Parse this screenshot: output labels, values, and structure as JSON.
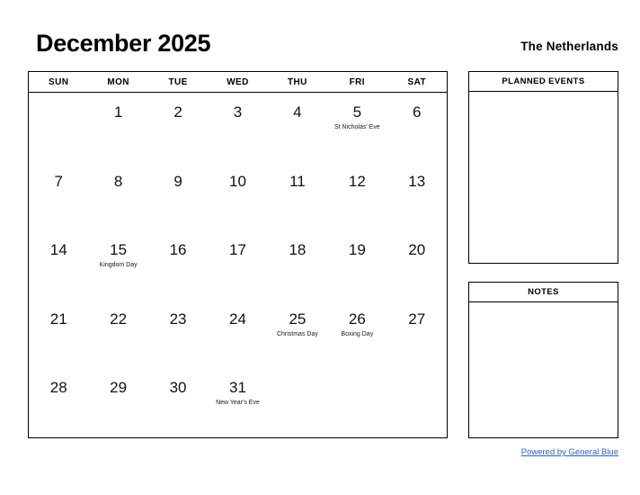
{
  "header": {
    "title": "December 2025",
    "region": "The Netherlands"
  },
  "calendar": {
    "weekdays": [
      "SUN",
      "MON",
      "TUE",
      "WED",
      "THU",
      "FRI",
      "SAT"
    ],
    "weeks": [
      [
        {
          "day": "",
          "event": ""
        },
        {
          "day": "1",
          "event": ""
        },
        {
          "day": "2",
          "event": ""
        },
        {
          "day": "3",
          "event": ""
        },
        {
          "day": "4",
          "event": ""
        },
        {
          "day": "5",
          "event": "St Nicholas' Eve"
        },
        {
          "day": "6",
          "event": ""
        }
      ],
      [
        {
          "day": "7",
          "event": ""
        },
        {
          "day": "8",
          "event": ""
        },
        {
          "day": "9",
          "event": ""
        },
        {
          "day": "10",
          "event": ""
        },
        {
          "day": "11",
          "event": ""
        },
        {
          "day": "12",
          "event": ""
        },
        {
          "day": "13",
          "event": ""
        }
      ],
      [
        {
          "day": "14",
          "event": ""
        },
        {
          "day": "15",
          "event": "Kingdom Day"
        },
        {
          "day": "16",
          "event": ""
        },
        {
          "day": "17",
          "event": ""
        },
        {
          "day": "18",
          "event": ""
        },
        {
          "day": "19",
          "event": ""
        },
        {
          "day": "20",
          "event": ""
        }
      ],
      [
        {
          "day": "21",
          "event": ""
        },
        {
          "day": "22",
          "event": ""
        },
        {
          "day": "23",
          "event": ""
        },
        {
          "day": "24",
          "event": ""
        },
        {
          "day": "25",
          "event": "Christmas Day"
        },
        {
          "day": "26",
          "event": "Boxing Day"
        },
        {
          "day": "27",
          "event": ""
        }
      ],
      [
        {
          "day": "28",
          "event": ""
        },
        {
          "day": "29",
          "event": ""
        },
        {
          "day": "30",
          "event": ""
        },
        {
          "day": "31",
          "event": "New Year's Eve"
        },
        {
          "day": "",
          "event": ""
        },
        {
          "day": "",
          "event": ""
        },
        {
          "day": "",
          "event": ""
        }
      ]
    ]
  },
  "panels": {
    "planned_events": {
      "title": "PLANNED EVENTS",
      "body": ""
    },
    "notes": {
      "title": "NOTES",
      "body": ""
    }
  },
  "footer": {
    "link_text": "Powered by General Blue",
    "link_color": "#2a63b5"
  }
}
